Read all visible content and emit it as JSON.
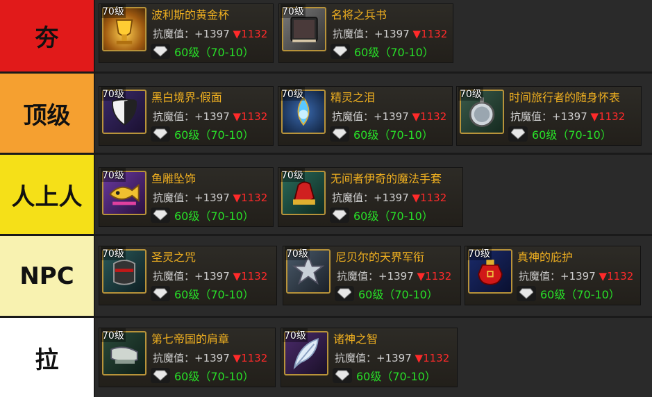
{
  "tiers": [
    {
      "label": "夯",
      "color": "#e11a1a",
      "items": [
        {
          "level": "70级",
          "name": "波利斯的黄金杯",
          "stat_label": "抗魔值：",
          "stat_value": "+1397",
          "drop": "▼1132",
          "req": "60级（70-10）",
          "icon": "golden-cup-icon"
        },
        {
          "level": "70级",
          "name": "名将之兵书",
          "stat_label": "抗魔值：",
          "stat_value": "+1397",
          "drop": "▼1132",
          "req": "60级（70-10）",
          "icon": "war-book-icon"
        }
      ]
    },
    {
      "label": "顶级",
      "color": "#f5a030",
      "items": [
        {
          "level": "70级",
          "name": "黑白境界-假面",
          "stat_label": "抗魔值：",
          "stat_value": "+1397",
          "drop": "▼1132",
          "req": "60级（70-10）",
          "icon": "mask-icon"
        },
        {
          "level": "70级",
          "name": "精灵之泪",
          "stat_label": "抗魔值：",
          "stat_value": "+1397",
          "drop": "▼1132",
          "req": "60级（70-10）",
          "icon": "teardrop-icon"
        },
        {
          "level": "70级",
          "name": "时间旅行者的随身怀表",
          "stat_label": "抗魔值：",
          "stat_value": "+1397",
          "drop": "▼1132",
          "req": "60级（70-10）",
          "icon": "pocket-watch-icon"
        }
      ]
    },
    {
      "label": "人上人",
      "color": "#f5e018",
      "items": [
        {
          "level": "70级",
          "name": "鱼雕坠饰",
          "stat_label": "抗魔值：",
          "stat_value": "+1397",
          "drop": "▼1132",
          "req": "60级（70-10）",
          "icon": "fish-pendant-icon"
        },
        {
          "level": "70级",
          "name": "无间者伊奇的魔法手套",
          "stat_label": "抗魔值：",
          "stat_value": "+1397",
          "drop": "▼1132",
          "req": "60级（70-10）",
          "icon": "magic-glove-icon"
        }
      ]
    },
    {
      "label": "NPC",
      "color": "#f8f2b0",
      "items": [
        {
          "level": "70级",
          "name": "圣灵之咒",
          "stat_label": "抗魔值：",
          "stat_value": "+1397",
          "drop": "▼1132",
          "req": "60级（70-10）",
          "icon": "helmet-icon"
        },
        {
          "level": "70级",
          "name": "尼贝尔的天界军衔",
          "stat_label": "抗魔值：",
          "stat_value": "+1397",
          "drop": "▼1132",
          "req": "60级（70-10）",
          "icon": "star-badge-icon"
        },
        {
          "level": "70级",
          "name": "真神的庇护",
          "stat_label": "抗魔值：",
          "stat_value": "+1397",
          "drop": "▼1132",
          "req": "60级（70-10）",
          "icon": "red-pouch-icon"
        }
      ]
    },
    {
      "label": "拉",
      "color": "#ffffff",
      "items": [
        {
          "level": "70级",
          "name": "第七帝国的肩章",
          "stat_label": "抗魔值：",
          "stat_value": "+1397",
          "drop": "▼1132",
          "req": "60级（70-10）",
          "icon": "epaulette-icon"
        },
        {
          "level": "70级",
          "name": "诸神之智",
          "stat_label": "抗魔值：",
          "stat_value": "+1397",
          "drop": "▼1132",
          "req": "60级（70-10）",
          "icon": "feather-icon"
        }
      ]
    }
  ]
}
